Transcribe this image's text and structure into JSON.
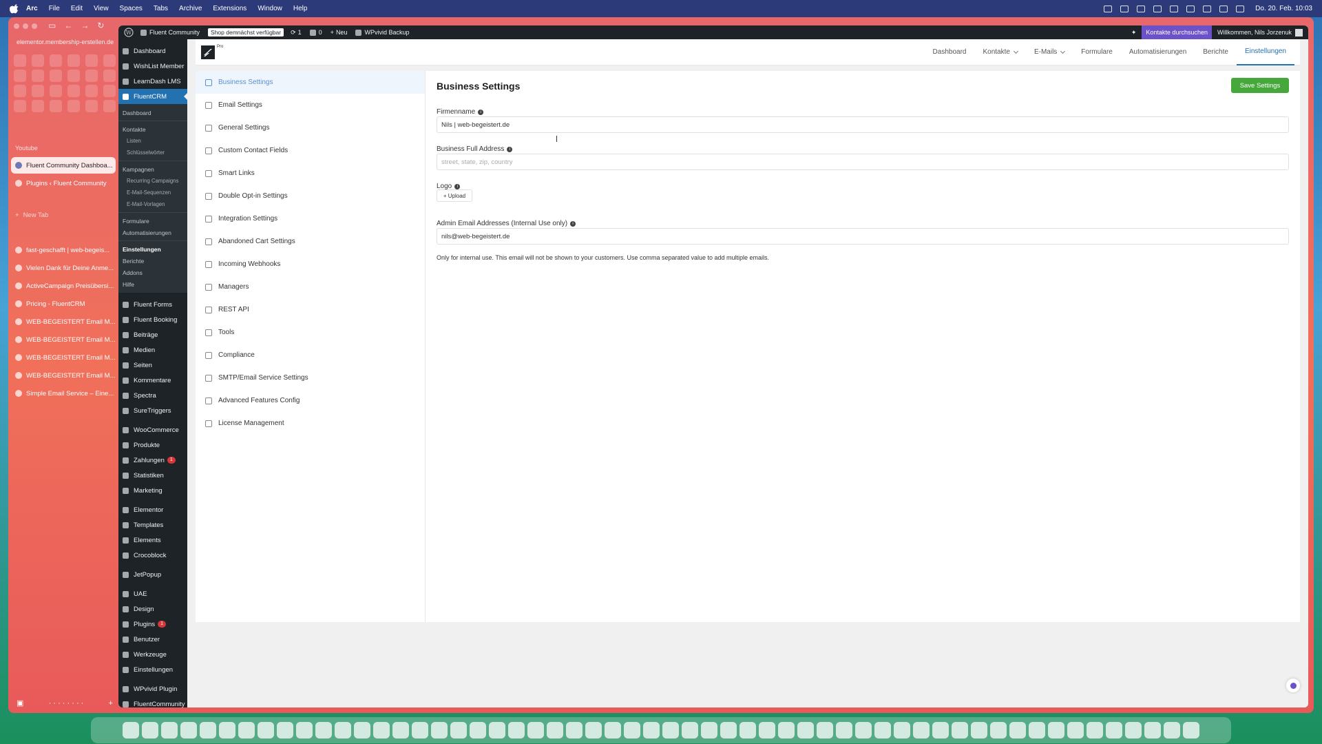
{
  "menubar": {
    "items": [
      "Arc",
      "File",
      "Edit",
      "View",
      "Spaces",
      "Tabs",
      "Archive",
      "Extensions",
      "Window",
      "Help"
    ],
    "clock": "Do. 20. Feb. 10:03"
  },
  "arc": {
    "url": "elementor.membership-erstellen.de",
    "space_label": "Youtube",
    "pinned_tabs": [
      {
        "label": "Fluent Community Dashboa..."
      },
      {
        "label": "Plugins ‹ Fluent Community"
      }
    ],
    "new_tab_label": "New Tab",
    "tabs": [
      {
        "label": "fast-geschafft | web-begeis..."
      },
      {
        "label": "Vielen Dank für Deine Anme..."
      },
      {
        "label": "ActiveCampaign Preisübersi..."
      },
      {
        "label": "Pricing - FluentCRM"
      },
      {
        "label": "WEB-BEGEISTERT Email M..."
      },
      {
        "label": "WEB-BEGEISTERT Email M..."
      },
      {
        "label": "WEB-BEGEISTERT Email M..."
      },
      {
        "label": "WEB-BEGEISTERT Email M..."
      },
      {
        "label": "Simple Email Service – Eine..."
      }
    ]
  },
  "adminbar": {
    "site_name": "Fluent Community",
    "shop_badge": "Shop demnächst verfügbar",
    "updates_count": "1",
    "comments_count": "0",
    "new_label": "Neu",
    "backup_label": "WPvivid Backup",
    "search_contacts": "Kontakte durchsuchen",
    "welcome": "Willkommen, Nils Jorzenuk"
  },
  "adminmenu": {
    "top": [
      {
        "label": "Dashboard"
      },
      {
        "label": "WishList Member"
      },
      {
        "label": "LearnDash LMS"
      }
    ],
    "current": "FluentCRM",
    "sub": {
      "dashboard": "Dashboard",
      "kontakte": "Kontakte",
      "listen": "Listen",
      "schluesselwoerter": "Schlüsselwörter",
      "kampagnen": "Kampagnen",
      "recurring": "Recurring Campaigns",
      "sequenzen": "E-Mail-Sequenzen",
      "vorlagen": "E-Mail-Vorlagen",
      "formulare": "Formulare",
      "automatisierungen": "Automatisierungen",
      "einstellungen": "Einstellungen",
      "berichte": "Berichte",
      "addons": "Addons",
      "hilfe": "Hilfe"
    },
    "rest": [
      {
        "label": "Fluent Forms",
        "badge": null
      },
      {
        "label": "Fluent Booking",
        "badge": null
      },
      {
        "label": "Beiträge",
        "badge": null
      },
      {
        "label": "Medien",
        "badge": null
      },
      {
        "label": "Seiten",
        "badge": null
      },
      {
        "label": "Kommentare",
        "badge": null
      },
      {
        "label": "Spectra",
        "badge": null
      },
      {
        "label": "SureTriggers",
        "badge": null
      }
    ],
    "woo": [
      {
        "label": "WooCommerce",
        "badge": null
      },
      {
        "label": "Produkte",
        "badge": null
      },
      {
        "label": "Zahlungen",
        "badge": "1"
      },
      {
        "label": "Statistiken",
        "badge": null
      },
      {
        "label": "Marketing",
        "badge": null
      }
    ],
    "builder": [
      {
        "label": "Elementor",
        "badge": null
      },
      {
        "label": "Templates",
        "badge": null
      },
      {
        "label": "Elements",
        "badge": null
      },
      {
        "label": "Crocoblock",
        "badge": null
      }
    ],
    "jet": [
      {
        "label": "JetPopup",
        "badge": null
      }
    ],
    "system": [
      {
        "label": "UAE",
        "badge": null
      },
      {
        "label": "Design",
        "badge": null
      },
      {
        "label": "Plugins",
        "badge": "1"
      },
      {
        "label": "Benutzer",
        "badge": null
      },
      {
        "label": "Werkzeuge",
        "badge": null
      },
      {
        "label": "Einstellungen",
        "badge": null
      }
    ],
    "bottom": [
      {
        "label": "WPvivid Plugin",
        "badge": null
      },
      {
        "label": "FluentCommunity",
        "badge": null
      }
    ]
  },
  "crm_nav": {
    "logo_suffix": "Pro",
    "links": [
      {
        "label": "Dashboard",
        "caret": false,
        "active": false
      },
      {
        "label": "Kontakte",
        "caret": true,
        "active": false
      },
      {
        "label": "E-Mails",
        "caret": true,
        "active": false
      },
      {
        "label": "Formulare",
        "caret": false,
        "active": false
      },
      {
        "label": "Automatisierungen",
        "caret": false,
        "active": false
      },
      {
        "label": "Berichte",
        "caret": false,
        "active": false
      },
      {
        "label": "Einstellungen",
        "caret": false,
        "active": true
      }
    ]
  },
  "settings_nav": [
    {
      "label": "Business Settings",
      "icon": "document-icon",
      "active": true
    },
    {
      "label": "Email Settings",
      "icon": "envelope-icon",
      "active": false
    },
    {
      "label": "General Settings",
      "icon": "sliders-icon",
      "active": false
    },
    {
      "label": "Custom Contact Fields",
      "icon": "user-icon",
      "active": false
    },
    {
      "label": "Smart Links",
      "icon": "link-icon",
      "active": false
    },
    {
      "label": "Double Opt-in Settings",
      "icon": "user-check-icon",
      "active": false
    },
    {
      "label": "Integration Settings",
      "icon": "puzzle-icon",
      "active": false
    },
    {
      "label": "Abandoned Cart Settings",
      "icon": "cart-icon",
      "active": false
    },
    {
      "label": "Incoming Webhooks",
      "icon": "webhook-icon",
      "active": false
    },
    {
      "label": "Managers",
      "icon": "users-icon",
      "active": false
    },
    {
      "label": "REST API",
      "icon": "api-icon",
      "active": false
    },
    {
      "label": "Tools",
      "icon": "wrench-icon",
      "active": false
    },
    {
      "label": "Compliance",
      "icon": "shield-icon",
      "active": false
    },
    {
      "label": "SMTP/Email Service Settings",
      "icon": "server-icon",
      "active": false
    },
    {
      "label": "Advanced Features Config",
      "icon": "settings-icon",
      "active": false
    },
    {
      "label": "License Management",
      "icon": "lock-icon",
      "active": false
    }
  ],
  "business": {
    "title": "Business Settings",
    "save_label": "Save Settings",
    "firmenname_label": "Firmenname",
    "firmenname_value": "Nils | web-begeistert.de",
    "address_label": "Business Full Address",
    "address_placeholder": "street, state, zip, country",
    "logo_label": "Logo",
    "upload_label": "+ Upload",
    "admin_email_label": "Admin Email Addresses (Internal Use only)",
    "admin_email_value": "nils@web-begeistert.de",
    "admin_email_help": "Only for internal use. This email will not be shown to your customers. Use comma separated value to add multiple emails."
  },
  "colors": {
    "primary": "#2271b1",
    "save_green": "#46a83a",
    "wp_dark": "#1d2327",
    "fluent_purple": "#6b52c8"
  }
}
